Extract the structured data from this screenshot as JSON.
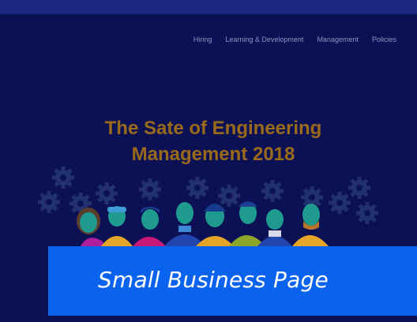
{
  "nav": {
    "items": [
      "Hiring",
      "Learning & Development",
      "Management",
      "Policies"
    ]
  },
  "hero": {
    "title_line1": "The Sate of Engineering",
    "title_line2": "Management 2018"
  },
  "banner": {
    "text": "Small Business Page"
  },
  "colors": {
    "background": "#0b1154",
    "top_bar": "#1c2780",
    "nav_text": "#8d93c2",
    "title": "#9a6a1b",
    "banner": "#0a63ee"
  },
  "icons": [
    "gear-icon"
  ]
}
